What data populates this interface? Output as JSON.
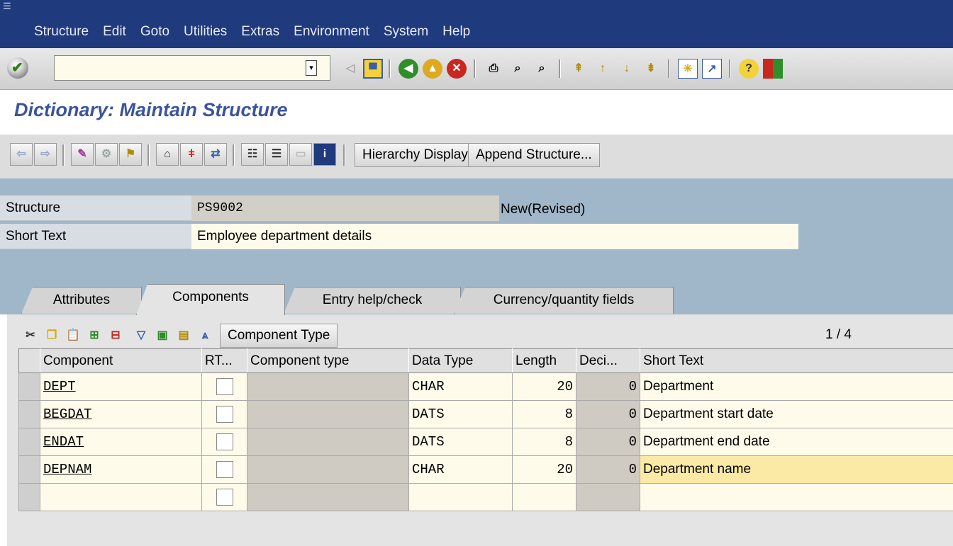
{
  "menu": [
    "Structure",
    "Edit",
    "Goto",
    "Utilities",
    "Extras",
    "Environment",
    "System",
    "Help"
  ],
  "command_field": {
    "value": ""
  },
  "standard_toolbar": {
    "icons": [
      "enter-icon",
      "back-arrow-icon",
      "save-icon",
      "back-icon",
      "exit-icon",
      "cancel-icon",
      "print-icon",
      "find-icon",
      "find-next-icon",
      "first-page-icon",
      "previous-page-icon",
      "next-page-icon",
      "last-page-icon",
      "create-session-icon",
      "shortcut-icon",
      "help-icon",
      "layout-icon"
    ]
  },
  "title": "Dictionary: Maintain Structure",
  "app_toolbar": {
    "icons": [
      "back-nav-icon",
      "forward-nav-icon",
      "display-change-icon",
      "check-icon",
      "activate-icon",
      "where-used-icon",
      "object-list-icon",
      "navigation-icon",
      "hierarchy-icon",
      "graphic-icon",
      "other-object-icon",
      "info-icon"
    ],
    "hierarchy_display": "Hierarchy Display",
    "append_structure": "Append Structure..."
  },
  "header": {
    "structure_label": "Structure",
    "structure_value": "PS9002",
    "status": "New(Revised)",
    "short_text_label": "Short Text",
    "short_text_value": "Employee department details"
  },
  "tabs": [
    "Attributes",
    "Components",
    "Entry help/check",
    "Currency/quantity fields"
  ],
  "active_tab": "Components",
  "table_toolbar": {
    "component_type_button": "Component Type",
    "pager_current": "1",
    "pager_sep": "/",
    "pager_total": "4"
  },
  "table": {
    "columns": [
      "Component",
      "RT...",
      "Component type",
      "Data Type",
      "Length",
      "Deci...",
      "Short Text"
    ],
    "rows": [
      {
        "component": "DEPT",
        "data_type": "CHAR",
        "length": "20",
        "decimals": "0",
        "short_text": "Department"
      },
      {
        "component": "BEGDAT",
        "data_type": "DATS",
        "length": "8",
        "decimals": "0",
        "short_text": "Department start date"
      },
      {
        "component": "ENDAT",
        "data_type": "DATS",
        "length": "8",
        "decimals": "0",
        "short_text": "Department end date"
      },
      {
        "component": "DEPNAM",
        "data_type": "CHAR",
        "length": "20",
        "decimals": "0",
        "short_text": "Department name"
      },
      {
        "component": "",
        "data_type": "",
        "length": "",
        "decimals": "",
        "short_text": ""
      }
    ]
  },
  "colors": {
    "menubar": "#1f3a7d",
    "title": "#3b54a0",
    "header_bg": "#9fb7c9",
    "input_bg": "#fffbea",
    "highlight": "#fbe9a6"
  }
}
